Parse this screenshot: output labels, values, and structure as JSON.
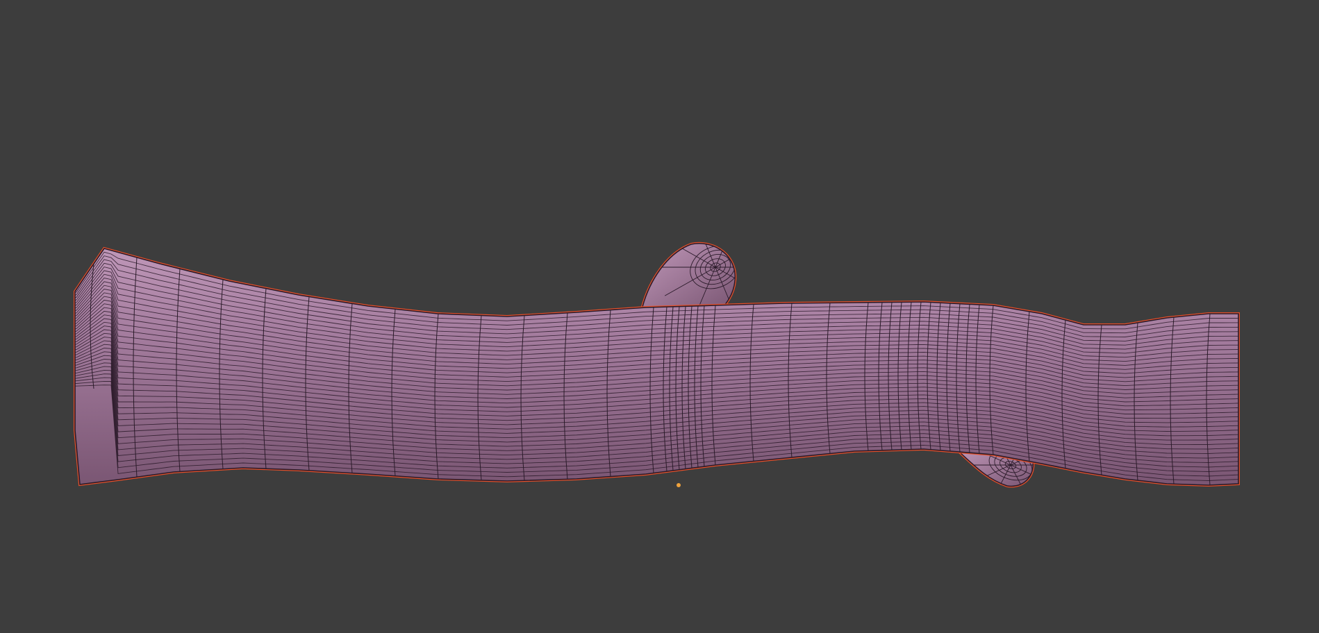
{
  "viewport": {
    "background_color": "#3d3d3d"
  },
  "mesh": {
    "object_kind": "branch",
    "face_color": "#a57d9f",
    "face_highlight_color": "#bf97b8",
    "face_shadow_color": "#7a5673",
    "wire_color": "#2a1a29",
    "selection_outline_color": "#e5502a",
    "display_mode": "solid-with-wireframe"
  },
  "origin_point": {
    "color": "#f0a23c",
    "icon": "origin-dot"
  }
}
